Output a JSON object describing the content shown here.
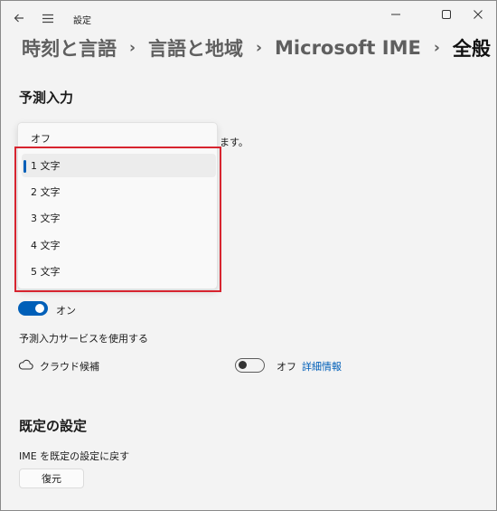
{
  "window": {
    "title": "設定"
  },
  "breadcrumb": {
    "items": [
      "時刻と言語",
      "言語と地域",
      "Microsoft IME",
      "全般"
    ],
    "separator": "›"
  },
  "sections": {
    "predictive": {
      "title": "予測入力",
      "partial_text": "ます。",
      "dropdown": {
        "current_value": "オフ",
        "options": [
          "1 文字",
          "2 文字",
          "3 文字",
          "4 文字",
          "5 文字"
        ],
        "selected_index": 0
      },
      "toggle": {
        "state": true,
        "label": "オン"
      },
      "service_label": "予測入力サービスを使用する",
      "cloud": {
        "label": "クラウド候補",
        "toggle_state": false,
        "toggle_label": "オフ",
        "link": "詳細情報",
        "icon": "cloud-icon"
      }
    },
    "defaults": {
      "title": "既定の設定",
      "reset_label": "IME を既定の設定に戻す",
      "restore_button": "復元"
    }
  },
  "colors": {
    "accent": "#005fb8",
    "highlight": "#d7242f",
    "background": "#f3f3f3"
  }
}
